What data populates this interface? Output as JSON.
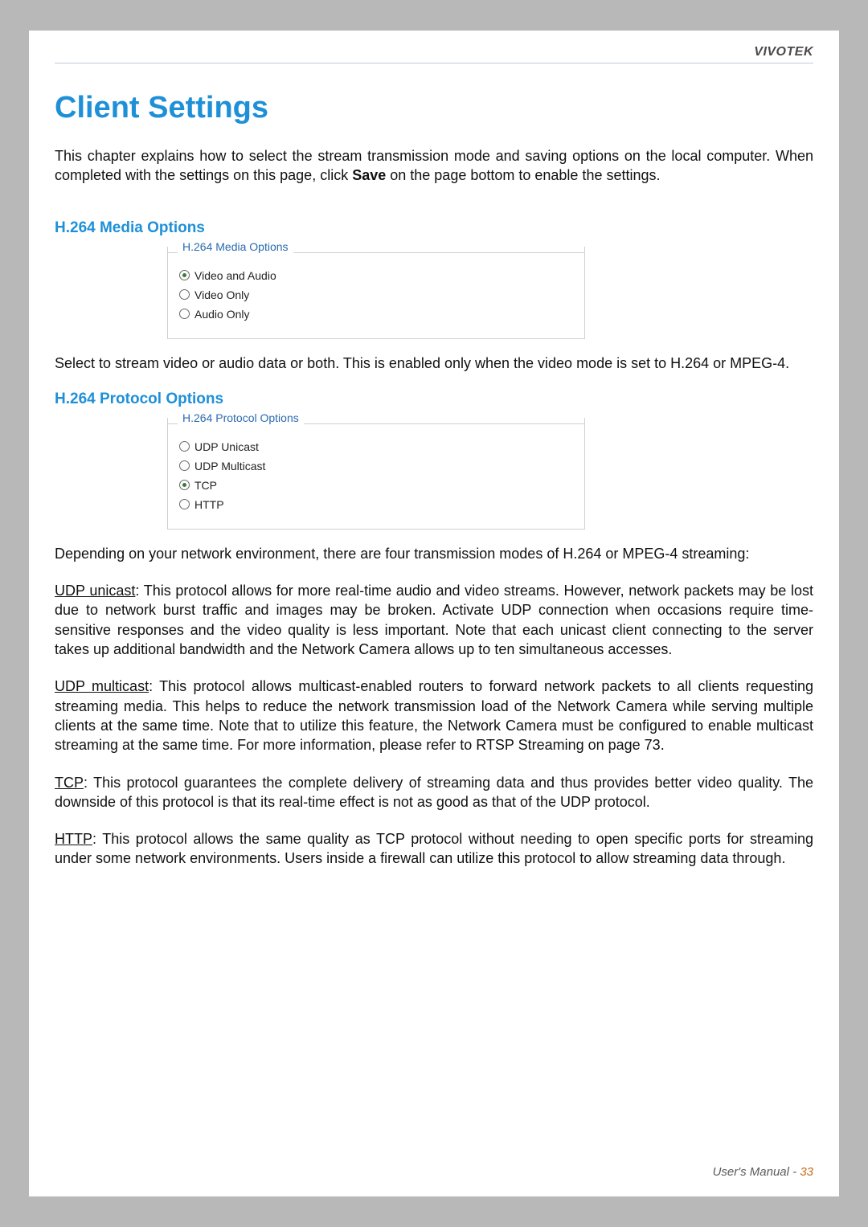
{
  "brand": "VIVOTEK",
  "page_title": "Client Settings",
  "intro_pre": "This chapter explains how to select the stream transmission mode and saving options on the local computer. When completed with the settings on this page, click ",
  "intro_bold": "Save",
  "intro_post": " on the page bottom to enable the settings.",
  "media": {
    "heading": "H.264 Media Options",
    "legend": "H.264 Media Options",
    "options": [
      {
        "label": "Video and Audio",
        "checked": true
      },
      {
        "label": "Video Only",
        "checked": false
      },
      {
        "label": "Audio Only",
        "checked": false
      }
    ],
    "note": "Select to stream video or audio data or both. This is enabled only when the video mode is set to H.264 or MPEG-4."
  },
  "protocol": {
    "heading": "H.264 Protocol Options",
    "legend": "H.264 Protocol Options",
    "options": [
      {
        "label": "UDP Unicast",
        "checked": false
      },
      {
        "label": "UDP Multicast",
        "checked": false
      },
      {
        "label": "TCP",
        "checked": true
      },
      {
        "label": "HTTP",
        "checked": false
      }
    ],
    "intro": "Depending on your network environment, there are four transmission modes of H.264 or MPEG-4 streaming:",
    "items": [
      {
        "term": "UDP unicast",
        "desc": ": This protocol allows for more real-time audio and video streams. However, network packets may be lost due to network burst traffic and images may be broken. Activate UDP connection when occasions require time-sensitive responses and the video quality is less important. Note that each unicast client connecting to the server takes up additional bandwidth and the Network Camera allows up to ten simultaneous accesses."
      },
      {
        "term": "UDP multicast",
        "desc": ": This protocol allows multicast-enabled routers to forward network packets to all clients requesting streaming media. This helps to reduce the network transmission load of the Network Camera while serving multiple clients at the same time. Note that to utilize this feature, the Network Camera must be configured to enable multicast streaming at the same time. For more information, please refer to RTSP Streaming on page 73."
      },
      {
        "term": "TCP",
        "desc": ": This protocol guarantees the complete delivery of streaming data and thus provides better video quality. The downside of this protocol is that its real-time effect is not as good as that of the UDP protocol."
      },
      {
        "term": "HTTP",
        "desc": ": This protocol allows the same quality as TCP protocol without needing to open specific ports for streaming under some network environments. Users inside a firewall can utilize this protocol to allow streaming data through."
      }
    ]
  },
  "footer_label": "User's Manual - ",
  "footer_page": "33"
}
